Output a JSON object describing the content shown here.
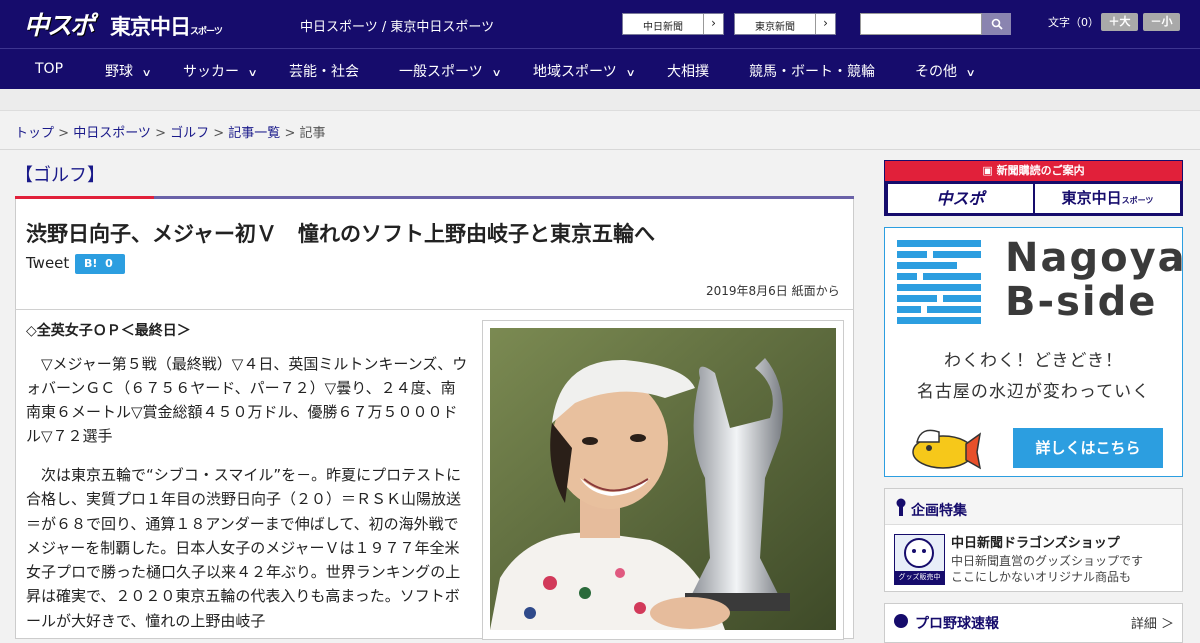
{
  "header": {
    "logo_chuspo": "中スポ",
    "logo_tokyo": "東京中日",
    "logo_tokyo_small": "スポーツ",
    "tagline": "中日スポーツ / 東京中日スポーツ",
    "paper_links": [
      {
        "label": "中日新聞"
      },
      {
        "label": "東京新聞"
      }
    ],
    "font_size_label": "文字（0）",
    "font_bigger": "＋大",
    "font_smaller": "－小",
    "search": {
      "value": "",
      "placeholder": ""
    },
    "colors": {
      "navy": "#160c6c",
      "red": "#e1203a",
      "blue": "#2c9ee0"
    }
  },
  "nav": [
    {
      "label": "TOP",
      "dropdown": false
    },
    {
      "label": "野球",
      "dropdown": true
    },
    {
      "label": "サッカー",
      "dropdown": true
    },
    {
      "label": "芸能・社会",
      "dropdown": false
    },
    {
      "label": "一般スポーツ",
      "dropdown": true
    },
    {
      "label": "地域スポーツ",
      "dropdown": true
    },
    {
      "label": "大相撲",
      "dropdown": false
    },
    {
      "label": "競馬・ボート・競輪",
      "dropdown": false
    },
    {
      "label": "その他",
      "dropdown": true
    }
  ],
  "breadcrumb": [
    "トップ",
    "中日スポーツ",
    "ゴルフ",
    "記事一覧",
    "記事"
  ],
  "article": {
    "category": "【ゴルフ】",
    "headline": "渋野日向子、メジャー初Ｖ　憧れのソフト上野由岐子と東京五輪へ",
    "tweet": "Tweet",
    "hatena_label": "B!",
    "hatena_count": "0",
    "date": "2019年8月6日 紙面から",
    "subheading": "◇全英女子ＯＰ＜最終日＞",
    "paragraphs": [
      "▽メジャー第５戦（最終戦）▽４日、英国ミルトンキーンズ、ウォバーンＧＣ（６７５６ヤード、パー７２）▽曇り、２４度、南南東６メートル▽賞金総額４５０万ドル、優勝６７万５０００ドル▽７２選手",
      "次は東京五輪で“シブコ・スマイル”を－。昨夏にプロテストに合格し、実質プロ１年目の渋野日向子（２０）＝ＲＳＫ山陽放送＝が６８で回り、通算１８アンダーまで伸ばして、初の海外戦でメジャーを制覇した。日本人女子のメジャーＶは１９７７年全米女子プロで勝った樋口久子以来４２年ぶり。世界ランキングの上昇は確実で、２０２０東京五輪の代表入りも高まった。ソフトボールが大好きで、憧れの上野由岐子"
    ]
  },
  "sidebar": {
    "subscribe_head": "新聞購読のご案内",
    "subscribe_logo1": "中スポ",
    "subscribe_logo2": "東京中日",
    "subscribe_logo2_small": "スポーツ",
    "ad_title_1": "Nagoya",
    "ad_title_2": "B-side",
    "ad_catch_1": "わくわく！どきどき！",
    "ad_catch_2": "名古屋の水辺が変わっていく",
    "ad_button": "詳しくはこちら",
    "kikaku_title": "企画特集",
    "kikaku_name": "中日新聞ドラゴンズショップ",
    "kikaku_desc1": "中日新聞直営のグッズショップです",
    "kikaku_desc2": "ここにしかないオリジナル商品も",
    "kikaku_thumb_text": "グッズ販売中",
    "pro_title": "プロ野球速報",
    "pro_more": "詳細 ＞"
  }
}
